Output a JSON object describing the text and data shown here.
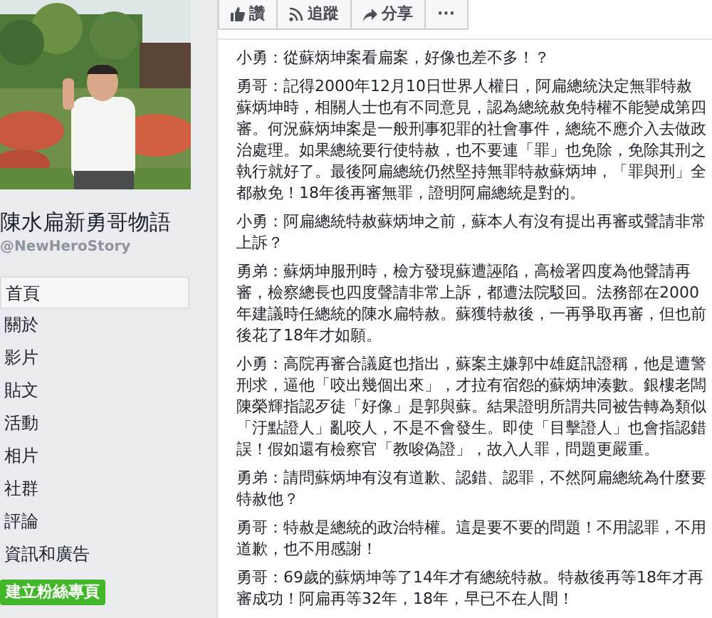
{
  "page": {
    "name": "陳水扁新勇哥物語",
    "handle": "@NewHeroStory"
  },
  "cover": {
    "kind": "picture"
  },
  "nav": [
    {
      "label": "首頁",
      "selected": true
    },
    {
      "label": "關於",
      "selected": false
    },
    {
      "label": "影片",
      "selected": false
    },
    {
      "label": "貼文",
      "selected": false
    },
    {
      "label": "活動",
      "selected": false
    },
    {
      "label": "相片",
      "selected": false
    },
    {
      "label": "社群",
      "selected": false
    },
    {
      "label": "評論",
      "selected": false
    },
    {
      "label": "資訊和廣告",
      "selected": false
    }
  ],
  "create_page_button": "建立粉絲專頁",
  "actions": [
    {
      "kind": "like",
      "label": "讚"
    },
    {
      "kind": "follow",
      "label": "追蹤"
    },
    {
      "kind": "share",
      "label": "分享"
    },
    {
      "kind": "more",
      "label": "···"
    }
  ],
  "paragraphs": [
    "小勇：從蘇炳坤案看扁案，好像也差不多！？",
    "勇哥：記得2000年12月10日世界人權日，阿扁總統決定無罪特赦蘇炳坤時，相關人士也有不同意見，認為總統赦免特權不能變成第四審。何況蘇炳坤案是一般刑事犯罪的社會事件，總統不應介入去做政治處理。如果總統要行使特赦，也不要連「罪」也免除，免除其刑之執行就好了。最後阿扁總統仍然堅持無罪特赦蘇炳坤，「罪與刑」全都赦免！18年後再審無罪，證明阿扁總統是對的。",
    "小勇：阿扁總統特赦蘇炳坤之前，蘇本人有沒有提出再審或聲請非常上訴？",
    "勇弟：蘇炳坤服刑時，檢方發現蘇遭誣陷，高檢署四度為他聲請再審，檢察總長也四度聲請非常上訴，都遭法院駁回。法務部在2000年建議時任總統的陳水扁特赦。蘇獲特赦後，一再爭取再審，但也前後花了18年才如願。",
    "小勇：高院再審合議庭也指出，蘇案主嫌郭中雄庭訊證稱，他是遭警刑求，逼他「咬出幾個出來」，才拉有宿怨的蘇炳坤湊數。銀樓老闆陳榮輝指認歹徒「好像」是郭與蘇。結果證明所謂共同被告轉為類似「汙點證人」亂咬人，不是不會發生。即使「目擊證人」也會指認錯誤！假如還有檢察官「教唆偽證」，故入人罪，問題更嚴重。",
    "勇弟：請問蘇炳坤有沒有道歉、認錯、認罪，不然阿扁總統為什麼要特赦他？",
    "勇哥：特赦是總統的政治特權。這是要不要的問題！不用認罪，不用道歉，也不用感謝！",
    "勇哥：69歲的蘇炳坤等了14年才有總統特赦。特赦後再等18年才再審成功！阿扁再等32年，18年，早已不在人間！"
  ]
}
